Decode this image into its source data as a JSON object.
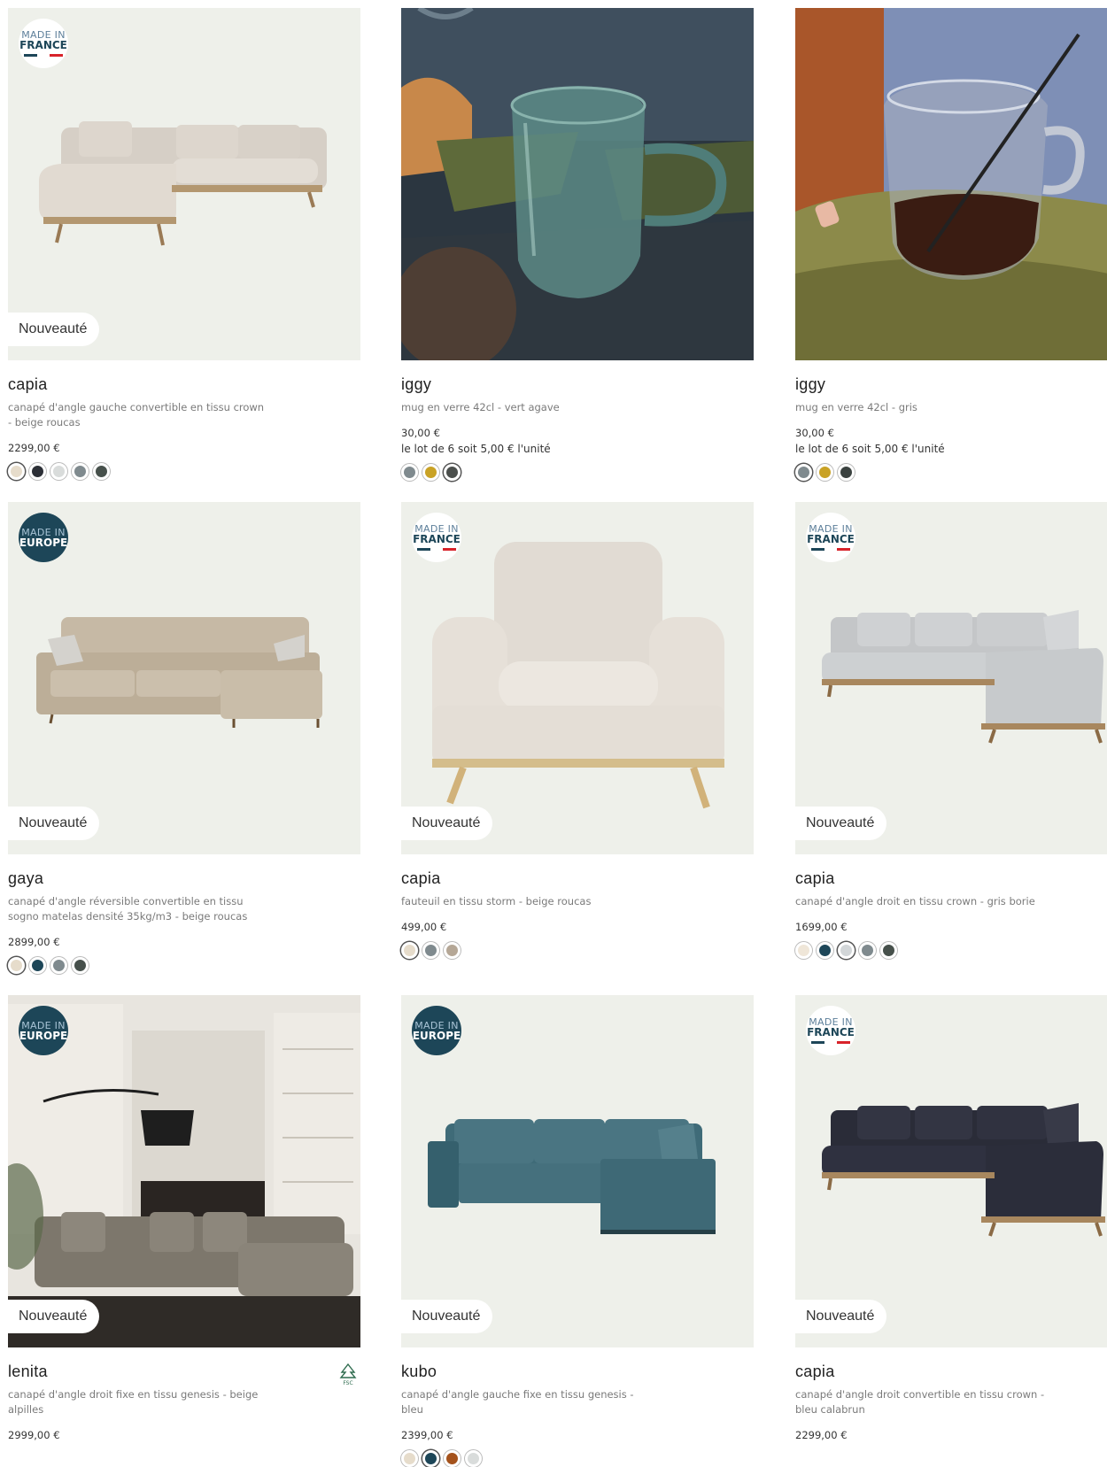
{
  "products": [
    {
      "name": "capia",
      "desc": "canapé d'angle gauche convertible en tissu crown - beige roucas",
      "price": "2299,00 €",
      "lot": "",
      "badge": "france",
      "novelty": "Nouveauté",
      "swatches": [
        "#e6dccb",
        "#2c2f36",
        "#d9dcdb",
        "#7f8a8e",
        "#46504b"
      ],
      "selected": 0
    },
    {
      "name": "iggy",
      "desc": "mug en verre 42cl - vert agave",
      "price": "30,00 €",
      "lot": "le lot de 6 soit 5,00 € l'unité",
      "badge": "",
      "novelty": "",
      "swatches": [
        "#7f8a8e",
        "#c9a225",
        "#4b4f4c"
      ],
      "selected": 2
    },
    {
      "name": "iggy",
      "desc": "mug en verre 42cl - gris",
      "price": "30,00 €",
      "lot": "le lot de 6 soit 5,00 € l'unité",
      "badge": "",
      "novelty": "",
      "swatches": [
        "#7f8a8e",
        "#c9a225",
        "#3b4240"
      ],
      "selected": 0
    },
    {
      "name": "gaya",
      "desc": "canapé d'angle réversible convertible en tissu sogno matelas densité 35kg/m3 - beige roucas",
      "price": "2899,00 €",
      "lot": "",
      "badge": "europe",
      "novelty": "Nouveauté",
      "swatches": [
        "#e6dccb",
        "#1d4658",
        "#7f8a8e",
        "#46504b"
      ],
      "selected": 0
    },
    {
      "name": "capia",
      "desc": "fauteuil en tissu storm - beige roucas",
      "price": "499,00 €",
      "lot": "",
      "badge": "france",
      "novelty": "Nouveauté",
      "swatches": [
        "#e6dccb",
        "#7f8a8e",
        "#b5a796"
      ],
      "selected": 0
    },
    {
      "name": "capia",
      "desc": "canapé d'angle droit en tissu crown - gris borie",
      "price": "1699,00 €",
      "lot": "",
      "badge": "france",
      "novelty": "Nouveauté",
      "swatches": [
        "#efe6d8",
        "#1d4658",
        "#d2d6d8",
        "#7f8a8e",
        "#46504b"
      ],
      "selected": 2
    },
    {
      "name": "lenita",
      "desc": "canapé d'angle droit fixe en tissu genesis - beige alpilles",
      "price": "2999,00 €",
      "lot": "",
      "badge": "europe",
      "novelty": "Nouveauté",
      "swatches": [],
      "selected": -1,
      "fsc": true
    },
    {
      "name": "kubo",
      "desc": "canapé d'angle gauche fixe en tissu genesis - bleu",
      "price": "2399,00 €",
      "lot": "",
      "badge": "europe",
      "novelty": "Nouveauté",
      "swatches": [
        "#e6dccb",
        "#1d4658",
        "#a4521c",
        "#d9dcdb"
      ],
      "selected": 1
    },
    {
      "name": "capia",
      "desc": "canapé d'angle droit convertible en tissu crown - bleu calabrun",
      "price": "2299,00 €",
      "lot": "",
      "badge": "france",
      "novelty": "Nouveauté",
      "swatches": [],
      "selected": -1
    }
  ],
  "badges": {
    "france": {
      "l1": "MADE IN",
      "l2": "FRANCE"
    },
    "europe": {
      "l1": "MADE IN",
      "l2": "EUROPE"
    }
  },
  "fsc_label": "FSC",
  "colors": {
    "bg_light": "#eef0ea",
    "navy": "#1d4658",
    "flag_blue": "#1d4658",
    "flag_red": "#d8232a"
  }
}
